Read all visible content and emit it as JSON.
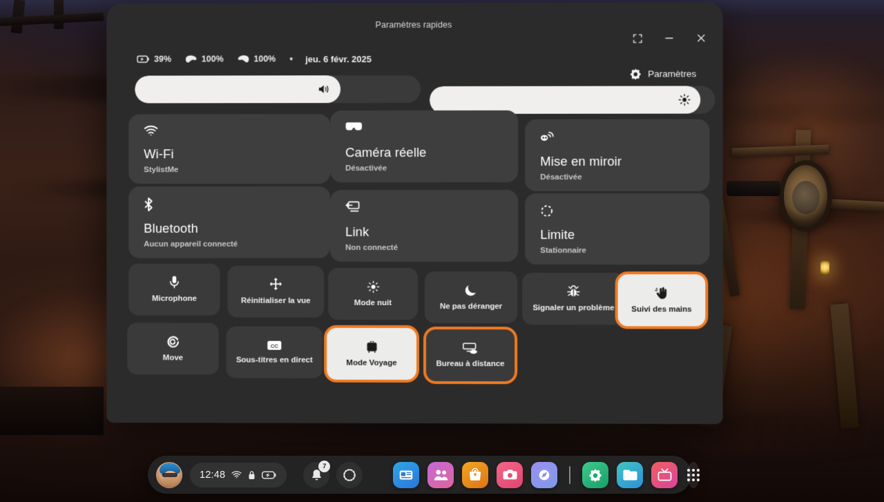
{
  "window": {
    "title": "Paramètres rapides",
    "controls": [
      {
        "name": "expand",
        "icon": "expand-icon",
        "label": "Agrandir"
      },
      {
        "name": "minimize",
        "icon": "minimize-icon",
        "label": "Réduire"
      },
      {
        "name": "close",
        "icon": "close-icon",
        "label": "Fermer"
      }
    ]
  },
  "status": {
    "battery": {
      "icon": "battery-charging-icon",
      "value": "39%"
    },
    "left_controller": {
      "icon": "controller-left-icon",
      "value": "100%"
    },
    "right_controller": {
      "icon": "controller-right-icon",
      "value": "100%"
    },
    "separator": "•",
    "date": "jeu. 6 févr. 2025"
  },
  "settings_link": {
    "icon": "gear-icon",
    "label": "Paramètres"
  },
  "sliders": {
    "volume": {
      "icon": "volume-icon",
      "label": "Volume",
      "percent": 72
    },
    "brightness": {
      "icon": "brightness-icon",
      "label": "Luminosité",
      "percent": 95
    }
  },
  "tiles": [
    {
      "icon": "wifi-icon",
      "title": "Wi-Fi",
      "subtitle": "StylistMe"
    },
    {
      "icon": "passthrough-icon",
      "title": "Caméra réelle",
      "subtitle": "Désactivée"
    },
    {
      "icon": "cast-icon",
      "title": "Mise en miroir",
      "subtitle": "Désactivée"
    },
    {
      "icon": "bluetooth-icon",
      "title": "Bluetooth",
      "subtitle": "Aucun appareil connecté"
    },
    {
      "icon": "link-icon",
      "title": "Link",
      "subtitle": "Non connecté"
    },
    {
      "icon": "boundary-icon",
      "title": "Limite",
      "subtitle": "Stationnaire"
    }
  ],
  "buttons": [
    {
      "icon": "microphone-icon",
      "label": "Microphone",
      "active": false,
      "highlighted": false
    },
    {
      "icon": "reset-view-icon",
      "label": "Réinitialiser la vue",
      "active": false,
      "highlighted": false
    },
    {
      "icon": "night-mode-icon",
      "label": "Mode nuit",
      "active": false,
      "highlighted": false
    },
    {
      "icon": "do-not-disturb-icon",
      "label": "Ne pas déranger",
      "active": false,
      "highlighted": false
    },
    {
      "icon": "bug-report-icon",
      "label": "Signaler un problème",
      "active": false,
      "highlighted": false
    },
    {
      "icon": "hand-tracking-icon",
      "label": "Suivi des mains",
      "active": true,
      "highlighted": true
    },
    {
      "icon": "move-icon",
      "label": "Move",
      "active": false,
      "highlighted": false
    },
    {
      "icon": "closed-captions-icon",
      "label": "Sous-titres en direct",
      "active": false,
      "highlighted": false
    },
    {
      "icon": "travel-mode-icon",
      "label": "Mode Voyage",
      "active": true,
      "highlighted": true
    },
    {
      "icon": "remote-desktop-icon",
      "label": "Bureau à distance",
      "active": false,
      "highlighted": true
    }
  ],
  "taskbar": {
    "avatar": {
      "label": "Profil"
    },
    "clock": {
      "time": "12:48",
      "icons": [
        "wifi-icon",
        "lock-icon",
        "battery-charging-icon"
      ]
    },
    "notifications": {
      "icon": "bell-icon",
      "badge": "7"
    },
    "loading": {
      "icon": "loading-spinner-icon"
    },
    "apps": [
      {
        "icon": "store-icon",
        "label": "Magasin",
        "color1": "#2aa8e8",
        "color2": "#2f74d8"
      },
      {
        "icon": "people-icon",
        "label": "Contacts",
        "color1": "#c36ad8",
        "color2": "#e0649b"
      },
      {
        "icon": "bag-icon",
        "label": "Boutique",
        "color1": "#f0a623",
        "color2": "#e07316"
      },
      {
        "icon": "camera-icon",
        "label": "Appareil photo",
        "color1": "#f4668a",
        "color2": "#e0456e"
      },
      {
        "icon": "browser-icon",
        "label": "Navigateur",
        "color1": "#9b8ff0",
        "color2": "#7f9ae8"
      },
      {
        "icon": "divider",
        "label": "Séparateur"
      },
      {
        "icon": "gear-icon",
        "label": "Paramètres",
        "color1": "#3fc98b",
        "color2": "#16a06a"
      },
      {
        "icon": "folder-icon",
        "label": "Fichiers",
        "color1": "#3fc6c0",
        "color2": "#2f8fd8"
      },
      {
        "icon": "tv-icon",
        "label": "TV",
        "color1": "#ef5f63",
        "color2": "#d9459a"
      }
    ],
    "app_library": {
      "icon": "grid-icon",
      "label": "Toutes les applications"
    }
  },
  "colors": {
    "highlight": "#ef7a22",
    "panel": "#2b2b2b",
    "tile": "#3e3e3e",
    "active": "#ececea"
  }
}
